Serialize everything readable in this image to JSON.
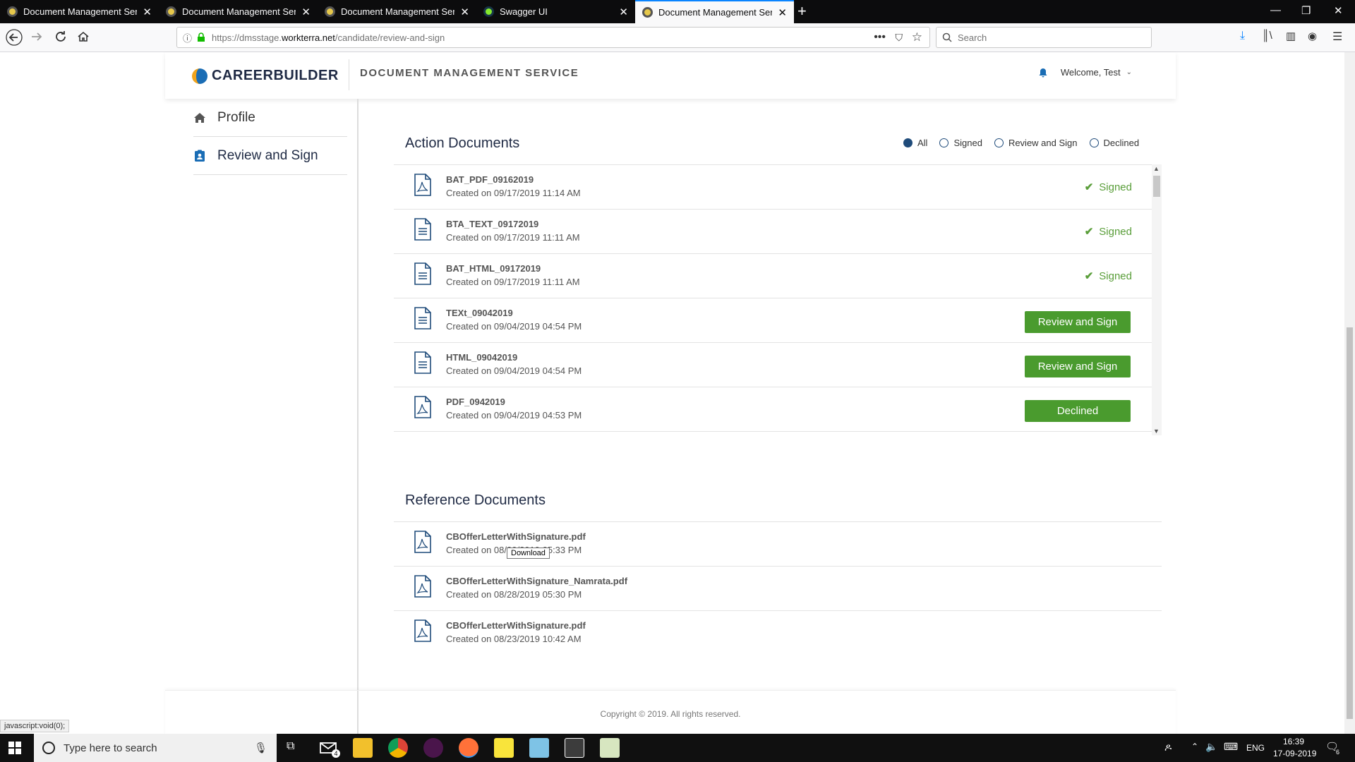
{
  "browser": {
    "tabs": [
      {
        "title": "Document Management Servic",
        "close": "✕"
      },
      {
        "title": "Document Management Servic",
        "close": "✕"
      },
      {
        "title": "Document Management Servic",
        "close": "✕"
      },
      {
        "title": "Swagger UI",
        "close": "✕"
      },
      {
        "title": "Document Management Servic",
        "close": "✕"
      }
    ],
    "new_tab": "+",
    "url_prefix": "https://dmsstage.",
    "url_domain": "workterra.net",
    "url_path": "/candidate/review-and-sign",
    "search_placeholder": "Search",
    "status_text": "javascript:void(0);"
  },
  "header": {
    "logo_text": "CAREERBUILDER",
    "app_title": "DOCUMENT MANAGEMENT SERVICE",
    "welcome": "Welcome, Test"
  },
  "sidebar": {
    "items": [
      {
        "label": "Profile"
      },
      {
        "label": "Review and Sign"
      }
    ]
  },
  "action": {
    "title": "Action Documents",
    "filters": [
      {
        "label": "All",
        "selected": true
      },
      {
        "label": "Signed",
        "selected": false
      },
      {
        "label": "Review and Sign",
        "selected": false
      },
      {
        "label": "Declined",
        "selected": false
      }
    ],
    "documents": [
      {
        "name": "BAT_PDF_09162019",
        "created": "Created on 09/17/2019 11:14 AM",
        "status": "Signed",
        "type": "pdf"
      },
      {
        "name": "BTA_TEXT_09172019",
        "created": "Created on 09/17/2019 11:11 AM",
        "status": "Signed",
        "type": "text"
      },
      {
        "name": "BAT_HTML_09172019",
        "created": "Created on 09/17/2019 11:11 AM",
        "status": "Signed",
        "type": "text"
      },
      {
        "name": "TEXt_09042019",
        "created": "Created on 09/04/2019 04:54 PM",
        "status": "Review and Sign",
        "type": "text"
      },
      {
        "name": "HTML_09042019",
        "created": "Created on 09/04/2019 04:54 PM",
        "status": "Review and Sign",
        "type": "text"
      },
      {
        "name": "PDF_0942019",
        "created": "Created on 09/04/2019 04:53 PM",
        "status": "Declined",
        "type": "pdf"
      }
    ]
  },
  "reference": {
    "title": "Reference Documents",
    "tooltip": "Download",
    "documents": [
      {
        "name": "CBOfferLetterWithSignature.pdf",
        "created": "Created on 08/30/2019 05:33 PM"
      },
      {
        "name": "CBOfferLetterWithSignature_Namrata.pdf",
        "created": "Created on 08/28/2019 05:30 PM"
      },
      {
        "name": "CBOfferLetterWithSignature.pdf",
        "created": "Created on 08/23/2019 10:42 AM"
      }
    ]
  },
  "footer": {
    "copyright": "Copyright © 2019. All rights reserved."
  },
  "taskbar": {
    "search_placeholder": "Type here to search",
    "mail_badge": "4",
    "lang": "ENG",
    "time": "16:39",
    "date": "17-09-2019",
    "notif_count": "6"
  },
  "colors": {
    "accent_green": "#4a9b2e",
    "navy": "#1f2a44",
    "browser_dark": "#0c0c0d"
  }
}
